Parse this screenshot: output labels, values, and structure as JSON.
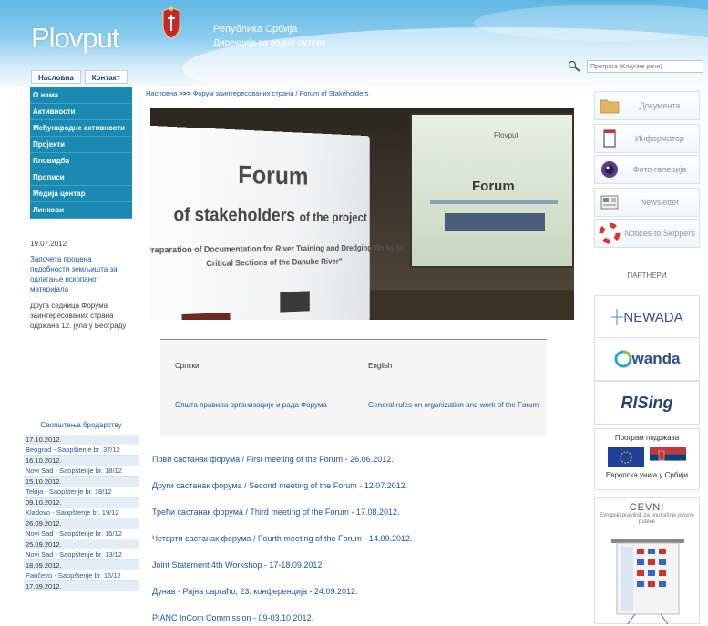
{
  "header": {
    "logo": "Plovput",
    "gov_line1": "Република Србија",
    "gov_line2": "Дирекција за водне путеве",
    "tabs": [
      "Насловна",
      "Контакт"
    ],
    "search_placeholder": "Претрага (Кључне речи)"
  },
  "leftnav": {
    "items": [
      "О нама",
      "Активности",
      "Међународне активности",
      "Пројекти",
      "Пловидба",
      "Прописи",
      "Медија центар",
      "Линкови"
    ]
  },
  "news": {
    "date": "19.07.2012",
    "link": "Започета процена подобности земљишта за одлагање ископаног материјала",
    "text": "Друга седница Форума заинтересованих страна одржана 12. јула у Београду"
  },
  "schedule": {
    "title": "Саопштења бродарству",
    "rows": [
      {
        "date": "17.10.2012.",
        "place": "Beograd - Saopštenje br. 37/12"
      },
      {
        "date": "16.10.2012.",
        "place": "Novi Sad - Saopštenje br. 18/12"
      },
      {
        "date": "15.10.2012.",
        "place": "Tekija - Saopštenje br. 18/12"
      },
      {
        "date": "09.10.2012.",
        "place": "Kladovo - Saopštenje br. 19/12"
      },
      {
        "date": "26.09.2012.",
        "place": "Novi Sad - Saopštenje br. 16/12"
      },
      {
        "date": "25.09.2012.",
        "place": "Novi Sad - Saopštenje br. 13/12"
      },
      {
        "date": "18.09.2012.",
        "place": "Pančevo - Saopštenje br. 16/12"
      },
      {
        "date": "17.09.2012.",
        "place": ""
      }
    ]
  },
  "breadcrumb": {
    "home": "Насловна",
    "arrow": ">>>",
    "path": "Форум заинтересованих страна / Forum of Stakeholders"
  },
  "hero": {
    "line1": "Forum",
    "line2a": "of stakeholders",
    "line2b": "of the project",
    "line3": "\"Preparation of Documentation for River Training and Dredging Works on",
    "line4": "Critical Sections of the Danube River\"",
    "back_title": "Forum",
    "back_top": "Plovput"
  },
  "docbox": {
    "lang_sr": "Српски",
    "lang_en": "English",
    "doc_sr": "Општа правила организације и рада Форума",
    "doc_en": "General rules on organization and work of the Forum"
  },
  "meetings": [
    "Први састанак форума / First meeting of the Forum - 26.06.2012.",
    "Други састанак форума / Second meeting of the Forum - 12.07.2012.",
    "Трећи састанак форума / Third meeting of the Forum - 17.08.2012.",
    "Четврти састанак форума / Fourth meeting of the Forum - 14.09.2012.",
    "Joint Statement 4th Workshop - 17-18.09.2012.",
    "Дунав - Рајна саргаћо, 23. конференција - 24.09.2012.",
    "PIANC InCom Commission - 09-03.10.2012."
  ],
  "rightcol": {
    "boxes": [
      "Документа",
      "Информатор",
      "Фото галерија",
      "Newsletter",
      "Notices to Skippers"
    ],
    "partners_title": "ПАРТНЕРИ",
    "newada": "NEWADA",
    "wanda": "wanda",
    "rising": "RISing",
    "program_title": "Програм подржава",
    "program_bottom": "Европска унија у Србији",
    "cevni_title": "CEVNI",
    "cevni_sub": "Evropski pravilnik za unutrašnje plovne puteve"
  },
  "colors": {
    "nav_bg": "#1a8ab3",
    "link": "#1c58a5",
    "header_top": "#5fb6e4"
  }
}
